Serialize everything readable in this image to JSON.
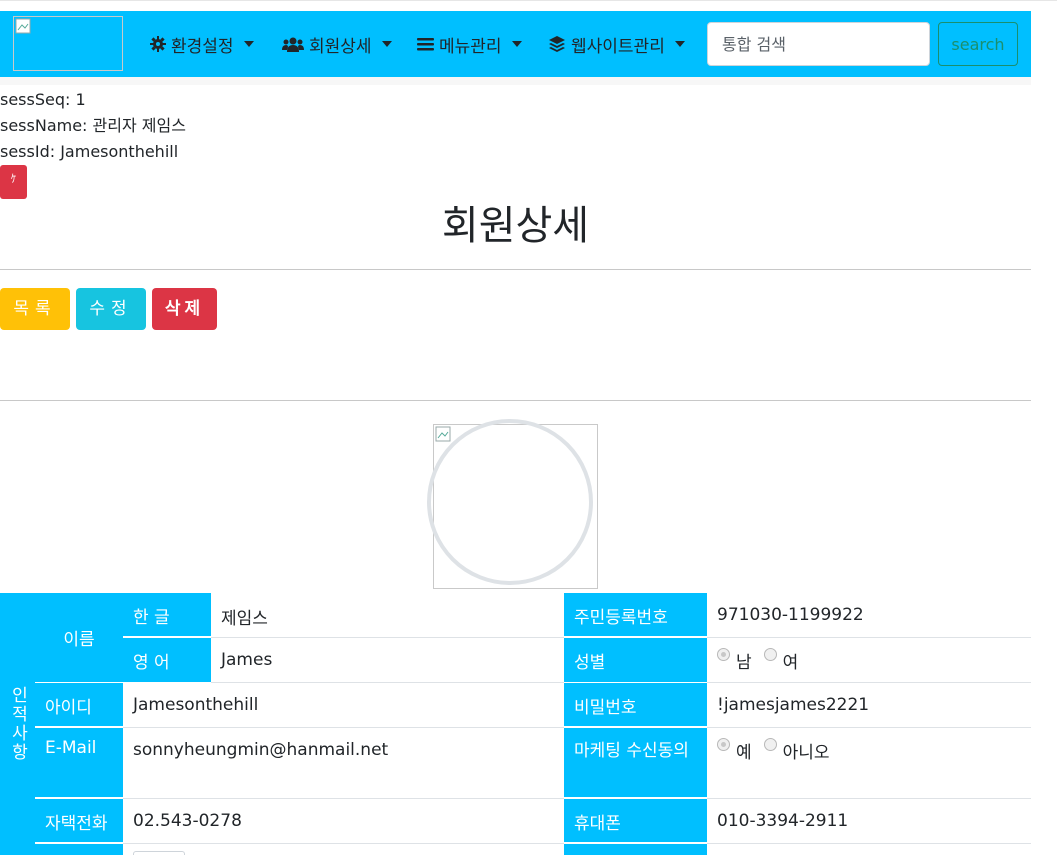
{
  "nav": {
    "menus": [
      {
        "label": "환경설정",
        "icon": "gear-icon"
      },
      {
        "label": "회원상세",
        "icon": "users-icon"
      },
      {
        "label": "메뉴관리",
        "icon": "list-icon"
      },
      {
        "label": "웹사이트관리",
        "icon": "layers-icon"
      }
    ],
    "search_placeholder": "통합 검색",
    "search_button": "search"
  },
  "session": {
    "seq": "sessSeq: 1",
    "name": "sessName: 관리자 제임스",
    "id": "sessId: Jamesonthehill",
    "logout_glyph": "ｹ"
  },
  "page": {
    "title": "회원상세",
    "buttons": {
      "list": "목록",
      "edit": "수정",
      "delete": "삭제"
    }
  },
  "member": {
    "section_label": "인적사항",
    "name_label": "이름",
    "korean_label": "한 글",
    "korean_name": "제임스",
    "english_label": "영 어",
    "english_name": "James",
    "rrn_label": "주민등록번호",
    "rrn": "971030-1199922",
    "gender_label": "성별",
    "gender_options": [
      "남",
      "여"
    ],
    "id_label": "아이디",
    "id": "Jamesonthehill",
    "password_label": "비밀번호",
    "password": "!jamesjames2221",
    "email_label": "E-Mail",
    "email": "sonnyheungmin@hanmail.net",
    "marketing_label": "마케팅 수신동의",
    "marketing_options": [
      "예",
      "아니오"
    ],
    "home_phone_label": "자택전화",
    "home_phone": "02.543-0278",
    "mobile_label": "휴대폰",
    "mobile": "010-3394-2911"
  },
  "colors": {
    "primary": "#00bfff",
    "warning": "#ffc107",
    "info": "#17c4e0",
    "danger": "#dc3545"
  }
}
